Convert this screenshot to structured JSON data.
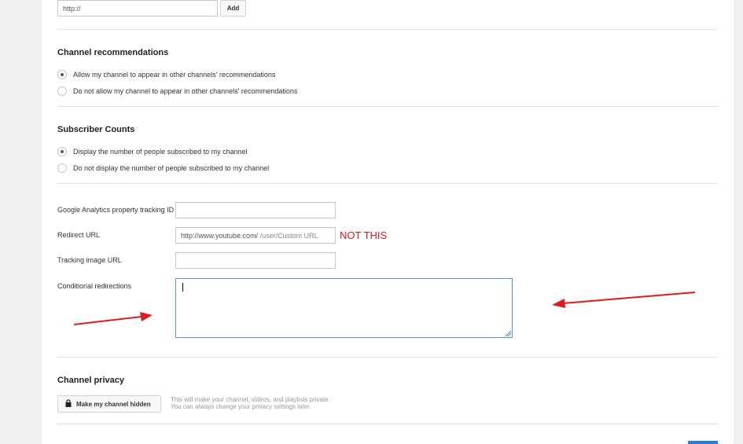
{
  "top_link": {
    "input_value": "http://",
    "add_label": "Add"
  },
  "recommendations": {
    "heading": "Channel recommendations",
    "options": [
      {
        "label": "Allow my channel to appear in other channels' recommendations",
        "checked": true
      },
      {
        "label": "Do not allow my channel to appear in other channels' recommendations",
        "checked": false
      }
    ]
  },
  "subscriber_counts": {
    "heading": "Subscriber Counts",
    "options": [
      {
        "label": "Display the number of people subscribed to my channel",
        "checked": true
      },
      {
        "label": "Do not display the number of people subscribed to my channel",
        "checked": false
      }
    ]
  },
  "tracking": {
    "analytics_label": "Google Analytics property tracking ID",
    "analytics_value": "",
    "redirect_label": "Redirect URL",
    "redirect_prefix": "http://www.youtube.com/",
    "redirect_placeholder": "/user/Custom URL",
    "tracking_image_label": "Tracking image URL",
    "tracking_image_value": "",
    "conditional_label": "Conditional redirections",
    "conditional_value": ""
  },
  "annotation": {
    "not_this": "NOT THIS",
    "color": "#d9181e"
  },
  "privacy": {
    "heading": "Channel privacy",
    "button_label": "Make my channel hidden",
    "button_icon": "lock-icon",
    "hint_line1": "This will make your channel, videos, and playlists private.",
    "hint_line2": "You can always change your privacy settings later."
  }
}
